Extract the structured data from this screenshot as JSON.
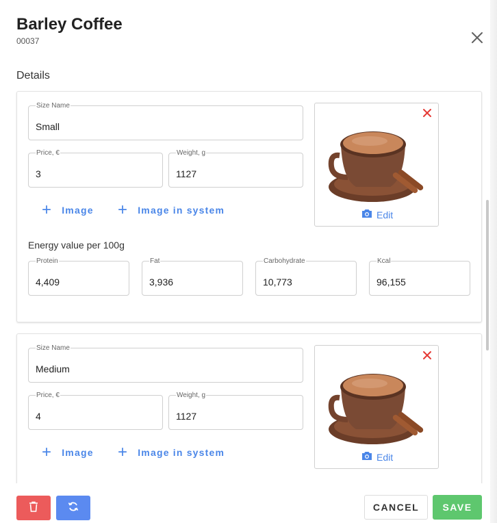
{
  "dialog": {
    "title": "Barley Coffee",
    "code": "00037",
    "section_label": "Details"
  },
  "sizes": [
    {
      "size_name_label": "Size Name",
      "size_name": "Small",
      "price_label": "Price, €",
      "price": "3",
      "weight_label": "Weight, g",
      "weight": "1127",
      "add_image_label": "Image",
      "add_image_system_label": "Image in system",
      "edit_label": "Edit",
      "energy_label": "Energy value per 100g",
      "protein_label": "Protein",
      "protein": "4,409",
      "fat_label": "Fat",
      "fat": "3,936",
      "carbohydrate_label": "Carbohydrate",
      "carbohydrate": "10,773",
      "kcal_label": "Kcal",
      "kcal": "96,155"
    },
    {
      "size_name_label": "Size Name",
      "size_name": "Medium",
      "price_label": "Price, €",
      "price": "4",
      "weight_label": "Weight, g",
      "weight": "1127",
      "add_image_label": "Image",
      "add_image_system_label": "Image in system",
      "edit_label": "Edit"
    }
  ],
  "footer": {
    "cancel_label": "CANCEL",
    "save_label": "SAVE"
  },
  "colors": {
    "accent_blue": "#4a86e8",
    "delete_red": "#ec5b5b",
    "sync_blue": "#5b8af0",
    "save_green": "#5ec76e",
    "remove_icon_red": "#e53935"
  },
  "icons": {
    "close": "close-icon",
    "remove_image": "remove-image-icon",
    "camera": "camera-icon",
    "plus": "plus-icon",
    "trash": "trash-icon",
    "sync": "sync-icon"
  }
}
